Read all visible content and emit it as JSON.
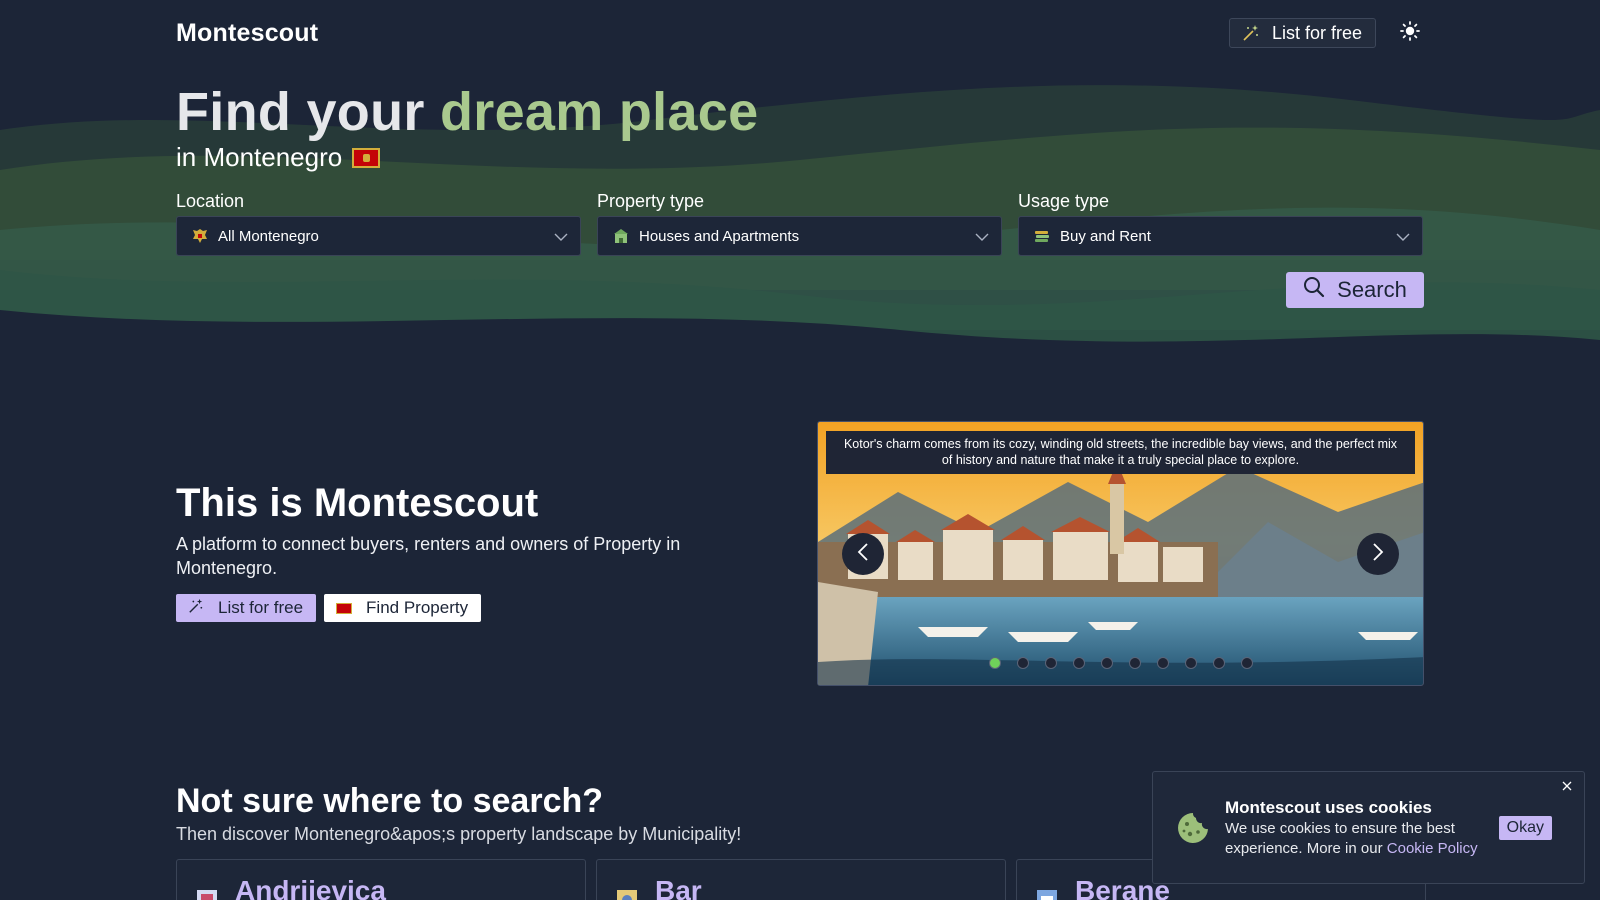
{
  "header": {
    "logo": "Montescout",
    "list_button": "List for free"
  },
  "hero": {
    "title_part1": "Find your",
    "title_part2": "dream place",
    "subtitle": "in Montenegro"
  },
  "filters": {
    "location": {
      "label": "Location",
      "value": "All Montenegro"
    },
    "property_type": {
      "label": "Property type",
      "value": "Houses and Apartments"
    },
    "usage_type": {
      "label": "Usage type",
      "value": "Buy and Rent"
    },
    "search_button": "Search"
  },
  "about": {
    "title": "This is Montescout",
    "description": "A platform to connect buyers, renters and owners of Property in Montenegro.",
    "list_button": "List for free",
    "find_button": "Find Property"
  },
  "carousel": {
    "caption": "Kotor's charm comes from its cozy, winding old streets, the incredible bay views, and the perfect mix of history and nature that make it a truly special place to explore.",
    "slide_count": 10,
    "active_index": 0
  },
  "municipalities": {
    "title": "Not sure where to search?",
    "subtitle": "Then discover Montenegro&apos;s property landscape by Municipality!",
    "cards": [
      {
        "name": "Andrijevica"
      },
      {
        "name": "Bar"
      },
      {
        "name": "Berane"
      }
    ]
  },
  "cookie": {
    "title": "Montescout uses cookies",
    "body": "We use cookies to ensure the best experience. More in our",
    "link": "Cookie Policy",
    "okay": "Okay"
  },
  "colors": {
    "background": "#1c2537",
    "accent_purple": "#c6b7f4",
    "accent_green": "#a9c98e",
    "active_dot": "#6fd05a"
  },
  "icons": [
    "magic-wand-icon",
    "sun-icon",
    "crest-icon",
    "building-icon",
    "money-stack-icon",
    "chevron-down-icon",
    "search-icon",
    "montenegro-flag-icon",
    "chevron-left-icon",
    "chevron-right-icon",
    "cookie-icon",
    "close-icon"
  ]
}
